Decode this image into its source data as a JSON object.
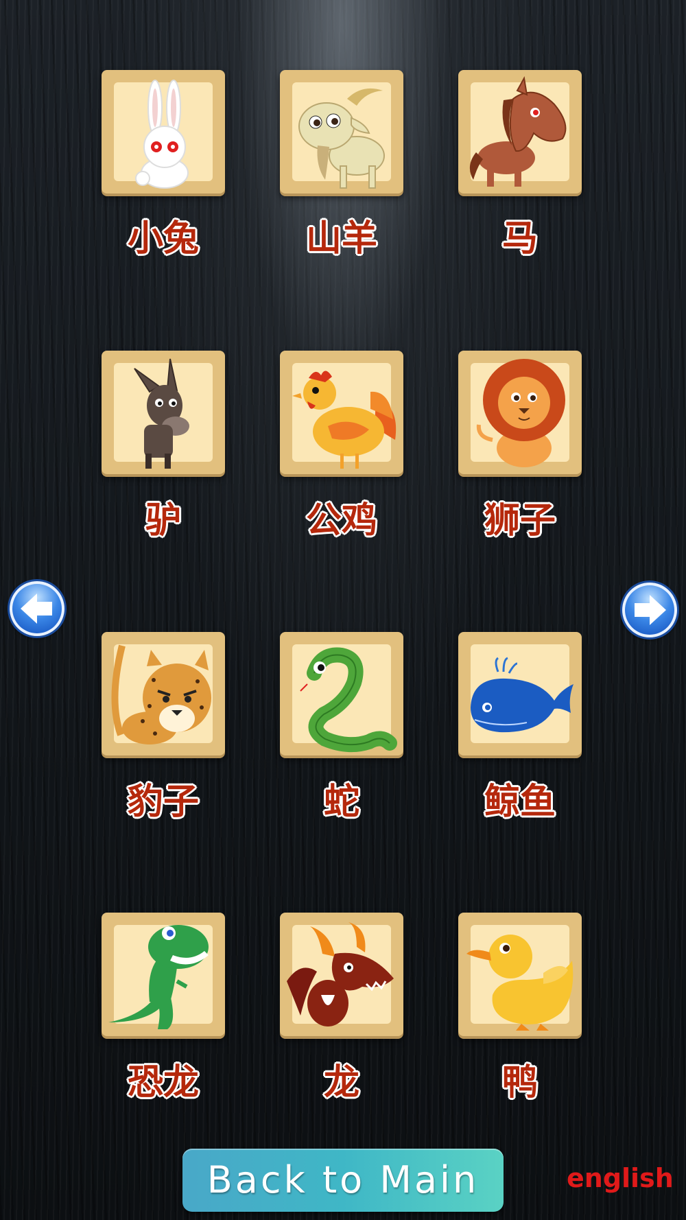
{
  "animals": [
    {
      "label": "小兔",
      "icon": "rabbit-icon"
    },
    {
      "label": "山羊",
      "icon": "goat-icon"
    },
    {
      "label": "马",
      "icon": "horse-icon"
    },
    {
      "label": "驴",
      "icon": "donkey-icon"
    },
    {
      "label": "公鸡",
      "icon": "rooster-icon"
    },
    {
      "label": "狮子",
      "icon": "lion-icon"
    },
    {
      "label": "豹子",
      "icon": "leopard-icon"
    },
    {
      "label": "蛇",
      "icon": "snake-icon"
    },
    {
      "label": "鲸鱼",
      "icon": "whale-icon"
    },
    {
      "label": "恐龙",
      "icon": "dinosaur-icon"
    },
    {
      "label": "龙",
      "icon": "dragon-icon"
    },
    {
      "label": "鸭",
      "icon": "duck-icon"
    }
  ],
  "nav": {
    "prev_icon": "arrow-left-icon",
    "next_icon": "arrow-right-icon"
  },
  "footer": {
    "back_label": "Back to Main",
    "language_label": "english"
  },
  "colors": {
    "label_text": "#b5280c",
    "card_border": "#e2c07e",
    "card_inner": "#fbe7b6",
    "back_button": "#3fb7c6",
    "language_text": "#e01a1a"
  }
}
